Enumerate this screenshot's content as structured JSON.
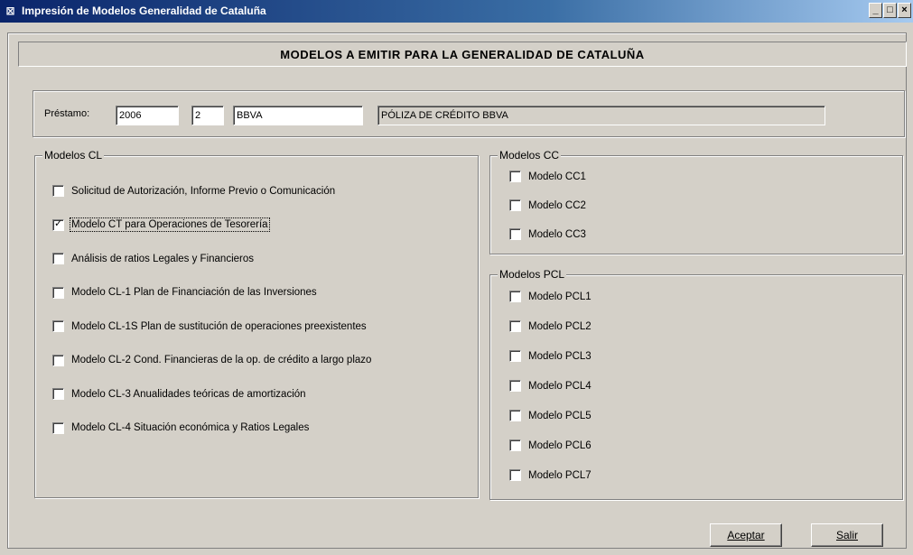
{
  "window": {
    "title": "Impresión de Modelos Generalidad de Cataluña",
    "app_icon": "app-icon",
    "minimize": "_",
    "maximize": "□",
    "close": "×"
  },
  "header": {
    "title": "MODELOS A EMITIR PARA LA GENERALIDAD DE CATALUÑA"
  },
  "prestamo": {
    "label": "Préstamo:",
    "year": "2006",
    "number": "2",
    "entity": "BBVA",
    "description": "PÓLIZA DE CRÉDITO BBVA"
  },
  "modelos_cl": {
    "title": "Modelos CL",
    "items": [
      {
        "label": "Solicitud de Autorización, Informe Previo o Comunicación",
        "checked": false
      },
      {
        "label": "Modelo CT para Operaciones de Tesorería",
        "checked": true
      },
      {
        "label": "Análisis de ratios Legales y Financieros",
        "checked": false
      },
      {
        "label": "Modelo CL-1 Plan de Financiación de las Inversiones",
        "checked": false
      },
      {
        "label": "Modelo CL-1S Plan de sustitución de operaciones preexistentes",
        "checked": false
      },
      {
        "label": "Modelo CL-2 Cond. Financieras de la op. de crédito a largo plazo",
        "checked": false
      },
      {
        "label": "Modelo CL-3 Anualidades teóricas de amortización",
        "checked": false
      },
      {
        "label": "Modelo CL-4 Situación económica y Ratios Legales",
        "checked": false
      }
    ]
  },
  "modelos_cc": {
    "title": "Modelos CC",
    "items": [
      {
        "label": "Modelo CC1",
        "checked": false
      },
      {
        "label": "Modelo CC2",
        "checked": false
      },
      {
        "label": "Modelo CC3",
        "checked": false
      }
    ]
  },
  "modelos_pcl": {
    "title": "Modelos PCL",
    "items": [
      {
        "label": "Modelo PCL1",
        "checked": false
      },
      {
        "label": "Modelo PCL2",
        "checked": false
      },
      {
        "label": "Modelo PCL3",
        "checked": false
      },
      {
        "label": "Modelo PCL4",
        "checked": false
      },
      {
        "label": "Modelo PCL5",
        "checked": false
      },
      {
        "label": "Modelo PCL6",
        "checked": false
      },
      {
        "label": "Modelo PCL7",
        "checked": false
      }
    ]
  },
  "buttons": {
    "accept": "Aceptar",
    "exit": "Salir"
  }
}
